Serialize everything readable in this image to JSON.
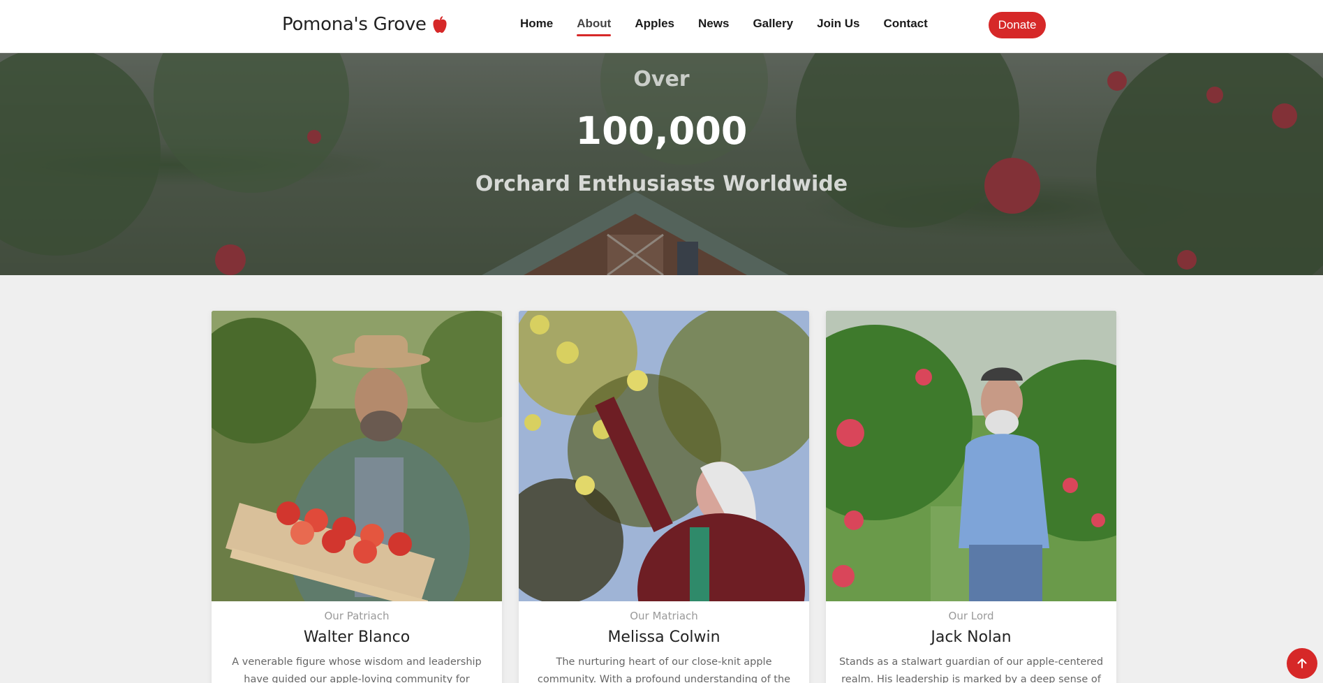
{
  "header": {
    "brand": "Pomona's Grove",
    "logo_icon": "apple-icon",
    "nav": [
      "Home",
      "About",
      "Apples",
      "News",
      "Gallery",
      "Join Us",
      "Contact"
    ],
    "active_nav": "About",
    "donate_label": "Donate"
  },
  "hero": {
    "over": "Over",
    "number": "100,000",
    "subtitle": "Orchard Enthusiasts Worldwide"
  },
  "team": [
    {
      "role": "Our Patriach",
      "name": "Walter Blanco",
      "description": "A venerable figure whose wisdom and leadership have guided our apple-loving community for generations. With a"
    },
    {
      "role": "Our Matriach",
      "name": "Melissa Colwin",
      "description": "The nurturing heart of our close-knit apple community. With a profound understanding of the emotional and"
    },
    {
      "role": "Our Lord",
      "name": "Jack Nolan",
      "description": "Stands as a stalwart guardian of our apple-centered realm. His leadership is marked by a deep sense of responsibility"
    }
  ],
  "scroll_top_icon": "arrow-up-icon",
  "colors": {
    "accent": "#d62828",
    "page_background": "#efefef",
    "header_background": "#ffffff"
  }
}
